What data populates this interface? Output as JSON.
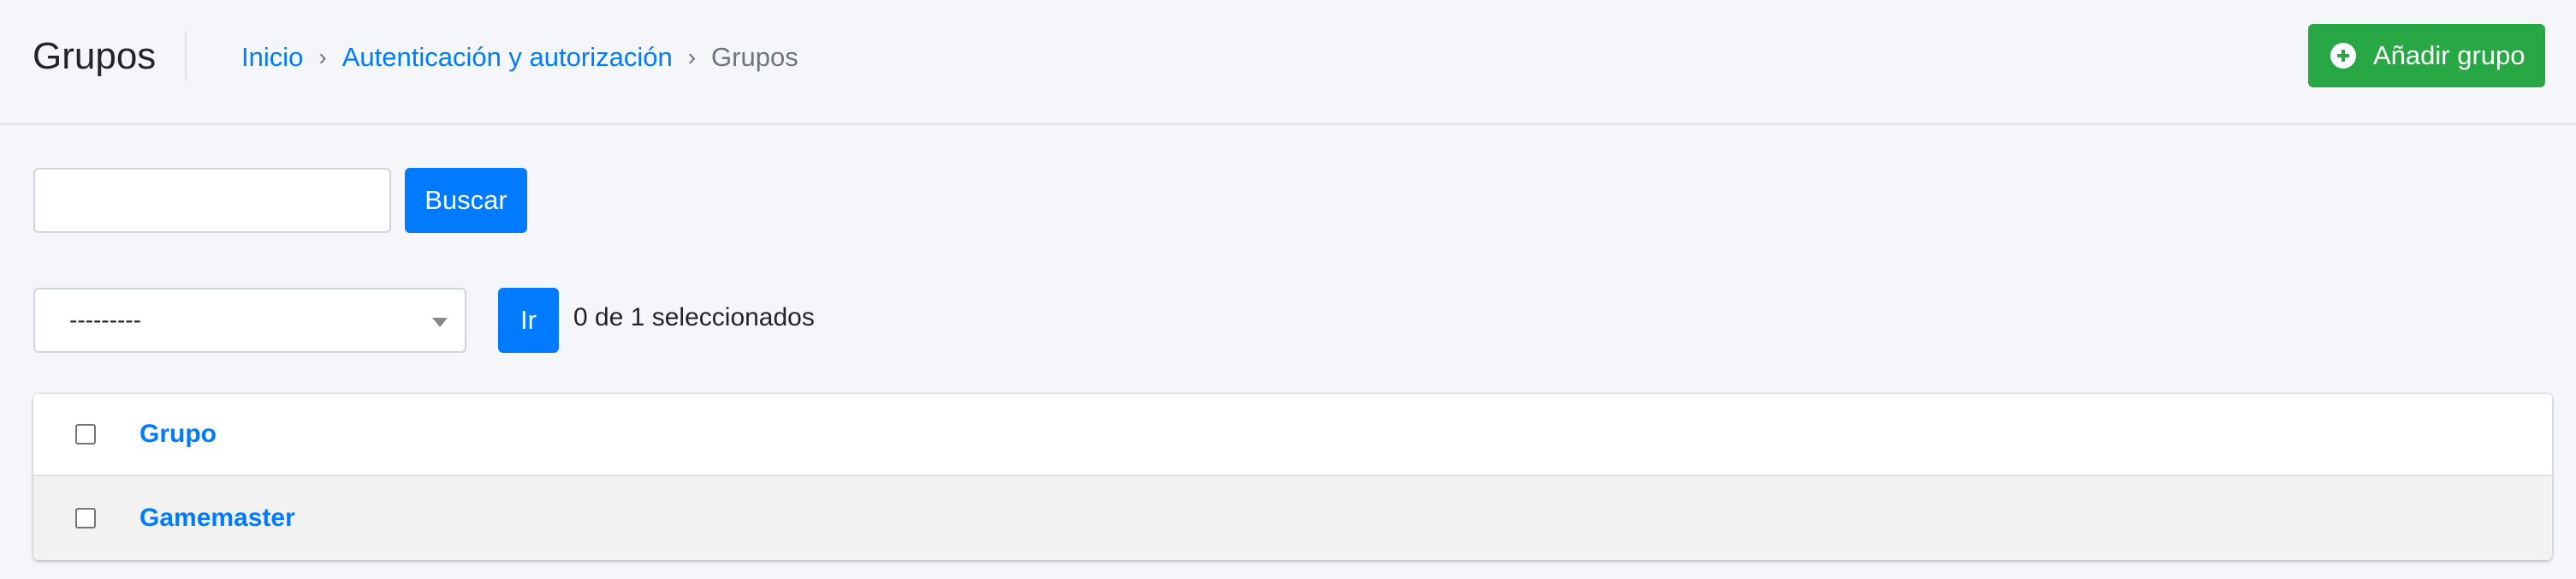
{
  "header": {
    "title": "Grupos",
    "breadcrumb": {
      "home": "Inicio",
      "separator": "›",
      "section": "Autenticación y autorización",
      "current": "Grupos"
    },
    "add_button": {
      "label": "Añadir grupo",
      "icon": "plus-circle-icon"
    }
  },
  "search": {
    "value": "",
    "placeholder": "",
    "button_label": "Buscar"
  },
  "actions": {
    "selected_option": "---------",
    "go_label": "Ir",
    "selection_count": "0 de 1 seleccionados"
  },
  "table": {
    "columns": [
      "Grupo"
    ],
    "rows": [
      {
        "name": "Gamemaster",
        "checked": false
      }
    ]
  },
  "colors": {
    "primary": "#007bff",
    "success": "#28a745",
    "background": "#f4f6f9"
  }
}
